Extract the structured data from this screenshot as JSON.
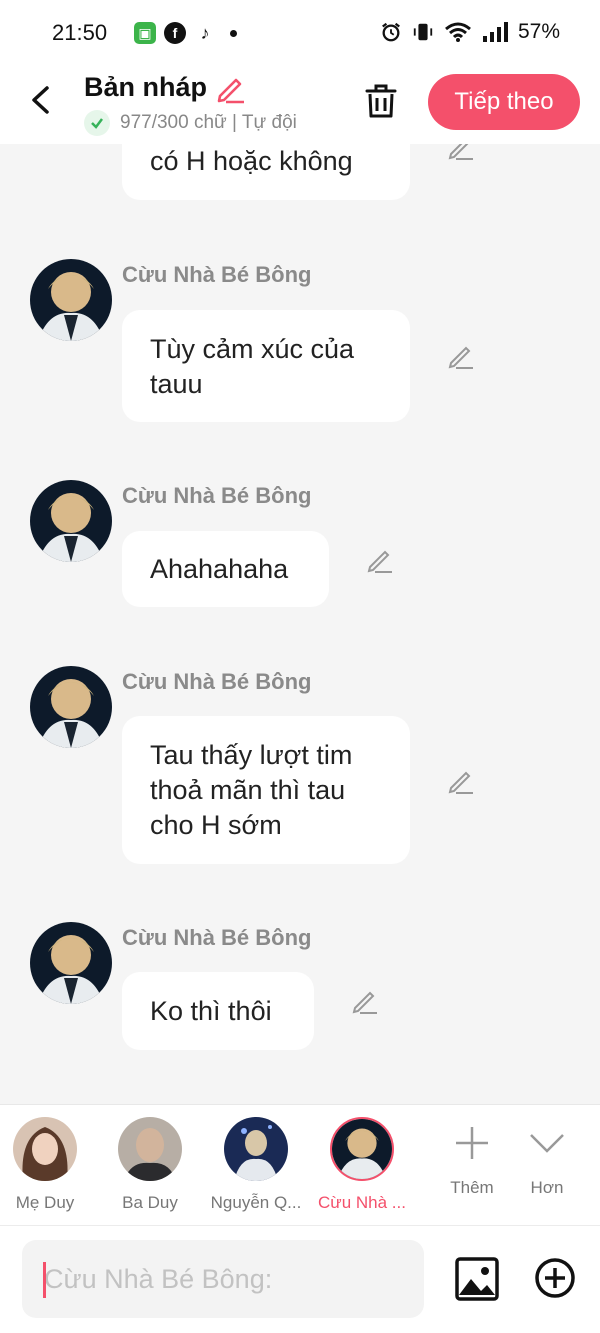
{
  "status": {
    "time": "21:50",
    "battery": "57%"
  },
  "header": {
    "title": "Bản nháp",
    "word_count": "977/300 chữ | Tự đội",
    "next_label": "Tiếp theo"
  },
  "messages": [
    {
      "name": "",
      "text": "có H hoặc không"
    },
    {
      "name": "Cừu Nhà Bé Bông",
      "text": "Tùy cảm xúc của tauu"
    },
    {
      "name": "Cừu Nhà Bé Bông",
      "text": "Ahahahaha"
    },
    {
      "name": "Cừu Nhà Bé Bông",
      "text": "Tau thấy lượt tim thoả mãn thì tau cho H sớm"
    },
    {
      "name": "Cừu Nhà Bé Bông",
      "text": "Ko thì thôi"
    }
  ],
  "characters": [
    {
      "name": "Mẹ Duy",
      "active": false
    },
    {
      "name": "Ba Duy",
      "active": false
    },
    {
      "name": "Nguyễn Q...",
      "active": false
    },
    {
      "name": "Cừu Nhà ...",
      "active": true
    }
  ],
  "char_actions": {
    "add_label": "Thêm",
    "more_label": "Hơn"
  },
  "input": {
    "placeholder": "Cừu Nhà Bé Bông:"
  },
  "colors": {
    "accent": "#f4506b",
    "background": "#f5f5f5"
  }
}
